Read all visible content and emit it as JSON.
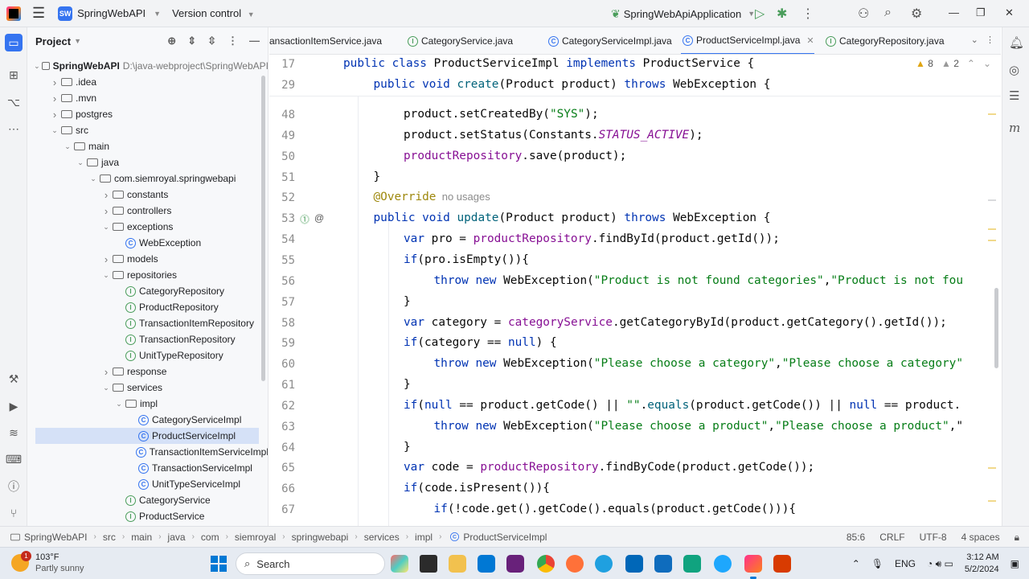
{
  "titlebar": {
    "project_name": "SpringWebAPI",
    "project_badge": "SW",
    "vcs_label": "Version control",
    "run_config": "SpringWebApiApplication"
  },
  "project_panel": {
    "title": "Project",
    "tree": [
      {
        "label": "SpringWebAPI",
        "path": "D:\\java-webproject\\SpringWebAPI",
        "icon": "folder",
        "arrow": "down",
        "depth": 0,
        "bold": true
      },
      {
        "label": ".idea",
        "icon": "folder",
        "arrow": "right",
        "depth": 1
      },
      {
        "label": ".mvn",
        "icon": "folder",
        "arrow": "right",
        "depth": 1
      },
      {
        "label": "postgres",
        "icon": "folder",
        "arrow": "right",
        "depth": 1
      },
      {
        "label": "src",
        "icon": "folder",
        "arrow": "down",
        "depth": 1
      },
      {
        "label": "main",
        "icon": "folder",
        "arrow": "down",
        "depth": 2
      },
      {
        "label": "java",
        "icon": "folder",
        "arrow": "down",
        "depth": 3
      },
      {
        "label": "com.siemroyal.springwebapi",
        "icon": "package",
        "arrow": "down",
        "depth": 4
      },
      {
        "label": "constants",
        "icon": "package",
        "arrow": "right",
        "depth": 5
      },
      {
        "label": "controllers",
        "icon": "package",
        "arrow": "right",
        "depth": 5
      },
      {
        "label": "exceptions",
        "icon": "package",
        "arrow": "down",
        "depth": 5
      },
      {
        "label": "WebException",
        "icon": "class",
        "arrow": "",
        "depth": 6
      },
      {
        "label": "models",
        "icon": "package",
        "arrow": "right",
        "depth": 5
      },
      {
        "label": "repositories",
        "icon": "package",
        "arrow": "down",
        "depth": 5
      },
      {
        "label": "CategoryRepository",
        "icon": "interface",
        "arrow": "",
        "depth": 6
      },
      {
        "label": "ProductRepository",
        "icon": "interface",
        "arrow": "",
        "depth": 6
      },
      {
        "label": "TransactionItemRepository",
        "icon": "interface",
        "arrow": "",
        "depth": 6
      },
      {
        "label": "TransactionRepository",
        "icon": "interface",
        "arrow": "",
        "depth": 6
      },
      {
        "label": "UnitTypeRepository",
        "icon": "interface",
        "arrow": "",
        "depth": 6
      },
      {
        "label": "response",
        "icon": "package",
        "arrow": "right",
        "depth": 5
      },
      {
        "label": "services",
        "icon": "package",
        "arrow": "down",
        "depth": 5
      },
      {
        "label": "impl",
        "icon": "package",
        "arrow": "down",
        "depth": 6
      },
      {
        "label": "CategoryServiceImpl",
        "icon": "class",
        "arrow": "",
        "depth": 7
      },
      {
        "label": "ProductServiceImpl",
        "icon": "class",
        "arrow": "",
        "depth": 7,
        "selected": true
      },
      {
        "label": "TransactionItemServiceImpl",
        "icon": "class",
        "arrow": "",
        "depth": 7
      },
      {
        "label": "TransactionServiceImpl",
        "icon": "class",
        "arrow": "",
        "depth": 7
      },
      {
        "label": "UnitTypeServiceImpl",
        "icon": "class",
        "arrow": "",
        "depth": 7
      },
      {
        "label": "CategoryService",
        "icon": "interface",
        "arrow": "",
        "depth": 6
      },
      {
        "label": "ProductService",
        "icon": "interface",
        "arrow": "",
        "depth": 6
      }
    ]
  },
  "tabs": [
    {
      "label": "ansactionItemService.java",
      "icon": "none",
      "active": false
    },
    {
      "label": "CategoryService.java",
      "icon": "interface",
      "active": false
    },
    {
      "label": "CategoryServiceImpl.java",
      "icon": "class",
      "active": false
    },
    {
      "label": "ProductServiceImpl.java",
      "icon": "class",
      "active": true
    },
    {
      "label": "CategoryRepository.java",
      "icon": "interface",
      "active": false
    }
  ],
  "inspections": {
    "warnings": "8",
    "weak_warnings": "2"
  },
  "editor": {
    "sticky": [
      {
        "num": "17",
        "indent": 0,
        "tokens": [
          [
            "kw",
            "public class "
          ],
          [
            "",
            "ProductServiceImpl "
          ],
          [
            "kw",
            "implements "
          ],
          [
            "",
            "ProductService {"
          ]
        ]
      },
      {
        "num": "29",
        "indent": 1,
        "tokens": [
          [
            "kw",
            "public void "
          ],
          [
            "fn",
            "create"
          ],
          [
            "",
            "(Product product) "
          ],
          [
            "kw",
            "throws "
          ],
          [
            "",
            "WebException {"
          ]
        ]
      }
    ],
    "lines": [
      {
        "num": "48",
        "indent": 2,
        "tokens": [
          [
            "",
            "product.setCreatedBy("
          ],
          [
            "str",
            "\"SYS\""
          ],
          [
            "",
            ");"
          ]
        ]
      },
      {
        "num": "49",
        "indent": 2,
        "tokens": [
          [
            "",
            "product.setStatus(Constants."
          ],
          [
            "ital",
            "STATUS_ACTIVE"
          ],
          [
            "",
            ");"
          ]
        ]
      },
      {
        "num": "50",
        "indent": 2,
        "tokens": [
          [
            "fld",
            "productRepository"
          ],
          [
            "",
            ".save(product);"
          ]
        ]
      },
      {
        "num": "51",
        "indent": 1,
        "tokens": [
          [
            "",
            "}"
          ]
        ]
      },
      {
        "num": "52",
        "indent": 1,
        "tokens": [
          [
            "ann",
            "@Override"
          ],
          [
            "hint",
            "  no usages"
          ]
        ]
      },
      {
        "num": "53",
        "indent": 1,
        "tokens": [
          [
            "kw",
            "public void "
          ],
          [
            "fn",
            "update"
          ],
          [
            "",
            "(Product product) "
          ],
          [
            "kw",
            "throws "
          ],
          [
            "",
            "WebException {"
          ]
        ]
      },
      {
        "num": "54",
        "indent": 2,
        "tokens": [
          [
            "kw",
            "var "
          ],
          [
            "",
            "pro = "
          ],
          [
            "fld",
            "productRepository"
          ],
          [
            "",
            ".findById(product.getId());"
          ]
        ]
      },
      {
        "num": "55",
        "indent": 2,
        "tokens": [
          [
            "kw",
            "if"
          ],
          [
            "",
            "(pro.isEmpty()){"
          ]
        ]
      },
      {
        "num": "56",
        "indent": 3,
        "tokens": [
          [
            "kw",
            "throw new "
          ],
          [
            "",
            "WebException("
          ],
          [
            "str",
            "\"Product is not found categories\""
          ],
          [
            "",
            ","
          ],
          [
            "str",
            "\"Product is not fou"
          ]
        ]
      },
      {
        "num": "57",
        "indent": 2,
        "tokens": [
          [
            "",
            "}"
          ]
        ]
      },
      {
        "num": "58",
        "indent": 2,
        "tokens": [
          [
            "kw",
            "var "
          ],
          [
            "",
            "category = "
          ],
          [
            "fld",
            "categoryService"
          ],
          [
            "",
            ".getCategoryById(product.getCategory().getId());"
          ]
        ]
      },
      {
        "num": "59",
        "indent": 2,
        "tokens": [
          [
            "kw",
            "if"
          ],
          [
            "",
            "(category == "
          ],
          [
            "kw",
            "null"
          ],
          [
            "",
            ") {"
          ]
        ]
      },
      {
        "num": "60",
        "indent": 3,
        "tokens": [
          [
            "kw",
            "throw new "
          ],
          [
            "",
            "WebException("
          ],
          [
            "str",
            "\"Please choose a category\""
          ],
          [
            "",
            ","
          ],
          [
            "str",
            "\"Please choose a category\""
          ]
        ]
      },
      {
        "num": "61",
        "indent": 2,
        "tokens": [
          [
            "",
            "}"
          ]
        ]
      },
      {
        "num": "62",
        "indent": 2,
        "tokens": [
          [
            "kw",
            "if"
          ],
          [
            "",
            "("
          ],
          [
            "kw",
            "null "
          ],
          [
            "",
            "== product.getCode() || "
          ],
          [
            "str",
            "\"\""
          ],
          [
            "",
            "."
          ],
          [
            "fn",
            "equals"
          ],
          [
            "",
            "(product.getCode()) || "
          ],
          [
            "kw",
            "null "
          ],
          [
            "",
            "== product."
          ]
        ]
      },
      {
        "num": "63",
        "indent": 3,
        "tokens": [
          [
            "kw",
            "throw new "
          ],
          [
            "",
            "WebException("
          ],
          [
            "str",
            "\"Please choose a product\""
          ],
          [
            "",
            ","
          ],
          [
            "str",
            "\"Please choose a product\""
          ],
          [
            "",
            ",\""
          ]
        ]
      },
      {
        "num": "64",
        "indent": 2,
        "tokens": [
          [
            "",
            "}"
          ]
        ]
      },
      {
        "num": "65",
        "indent": 2,
        "tokens": [
          [
            "kw",
            "var "
          ],
          [
            "",
            "code = "
          ],
          [
            "fld",
            "productRepository"
          ],
          [
            "",
            ".findByCode(product.getCode());"
          ]
        ]
      },
      {
        "num": "66",
        "indent": 2,
        "tokens": [
          [
            "kw",
            "if"
          ],
          [
            "",
            "(code.isPresent()){"
          ]
        ]
      },
      {
        "num": "67",
        "indent": 3,
        "tokens": [
          [
            "kw",
            "if"
          ],
          [
            "",
            "(!code.get().getCode().equals(product.getCode())){"
          ]
        ]
      }
    ]
  },
  "breadcrumb": [
    "SpringWebAPI",
    "src",
    "main",
    "java",
    "com",
    "siemroyal",
    "springwebapi",
    "services",
    "impl",
    "ProductServiceImpl"
  ],
  "status": {
    "position": "85:6",
    "line_sep": "CRLF",
    "encoding": "UTF-8",
    "indent": "4 spaces"
  },
  "taskbar": {
    "temp": "103°F",
    "weather": "Partly sunny",
    "weather_badge": "1",
    "search_placeholder": "Search",
    "lang": "ENG",
    "time": "3:12 AM",
    "date": "5/2/2024"
  },
  "colors": {
    "accent": "#3574f0",
    "keyword": "#0033b3",
    "string": "#067d17",
    "field": "#871094",
    "annotation": "#9e880d"
  }
}
